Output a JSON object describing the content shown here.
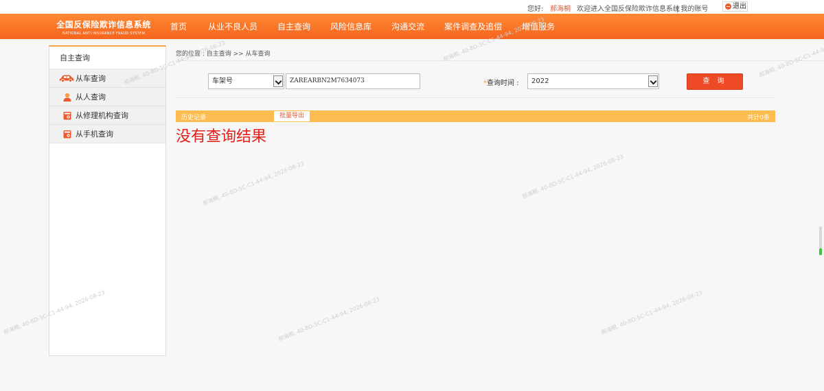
{
  "topbar": {
    "greeting": "您好:",
    "username": "郝海桐",
    "welcome": "欢迎进入全国反保险欺诈信息系统",
    "my_account": "| 我的账号",
    "logout": "退出"
  },
  "header": {
    "logo_cn": "全国反保险欺诈信息系统",
    "logo_en": "NATIONAL ANTI INSURANCE FRAUD SYSTEM",
    "nav": [
      "首页",
      "从业不良人员",
      "自主查询",
      "风险信息库",
      "沟通交流",
      "案件调查及追偿",
      "增值服务"
    ]
  },
  "sidebar": {
    "title": "自主查询",
    "items": [
      {
        "label": "从车查询",
        "icon": "car-icon"
      },
      {
        "label": "从人查询",
        "icon": "person-icon"
      },
      {
        "label": "从修理机构查询",
        "icon": "document-icon"
      },
      {
        "label": "从手机查询",
        "icon": "document-icon"
      }
    ]
  },
  "breadcrumb": "您的位置 : 自主查询 >> 从车查询",
  "search": {
    "type_selected": "车架号",
    "vin_value": "ZAREARBN2M7634073",
    "time_label": "查询时间 :",
    "time_required_mark": "*",
    "time_selected": "2022",
    "button_label": "查 询"
  },
  "results": {
    "history_label": "历史记录",
    "export_label": "批量导出",
    "total_label": "共计0条",
    "empty_message": "没有查询结果"
  },
  "watermark": "郝海桐, 40-8D-5C-C1-44-94, 2026-08-23",
  "colors": {
    "header_orange": "#f5641f",
    "accent_yellow": "#fdbc4f",
    "query_button": "#ef4a26",
    "empty_message": "#e31e17"
  }
}
